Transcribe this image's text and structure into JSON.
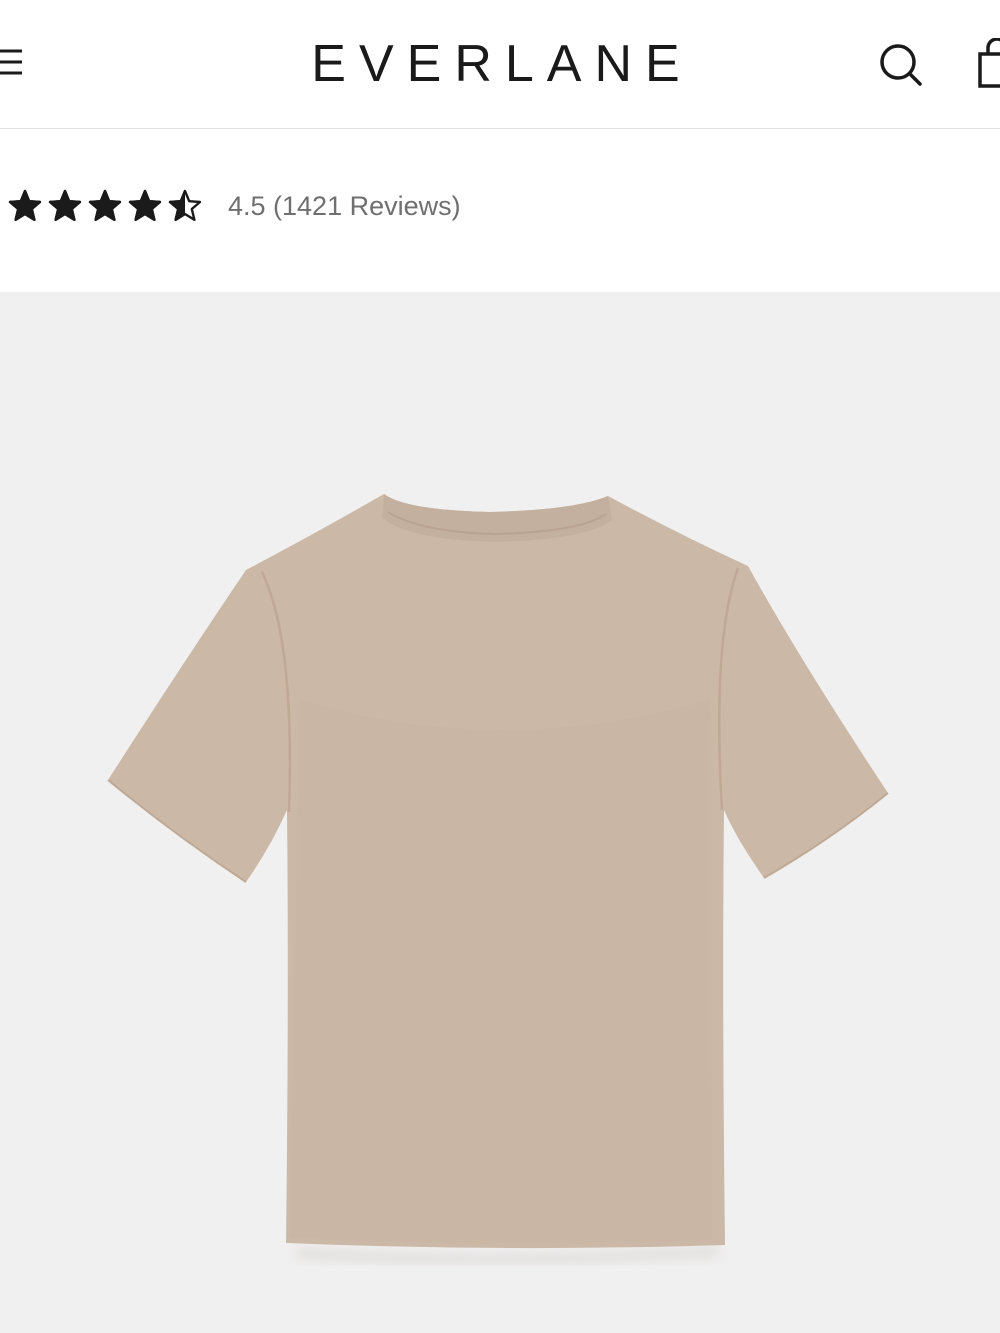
{
  "header": {
    "brand": "EVERLANE",
    "menu_icon": "menu-icon",
    "search_icon": "search-icon",
    "bag_icon": "shopping-bag-icon"
  },
  "rating": {
    "score": 4.5,
    "max": 5,
    "text": "4.5 (1421 Reviews)",
    "star_color": "#1a1a1a"
  },
  "product": {
    "image_icon": "t-shirt-product-image",
    "shirt_color": "#cbb8a6",
    "background_color": "#f1f0f0"
  }
}
